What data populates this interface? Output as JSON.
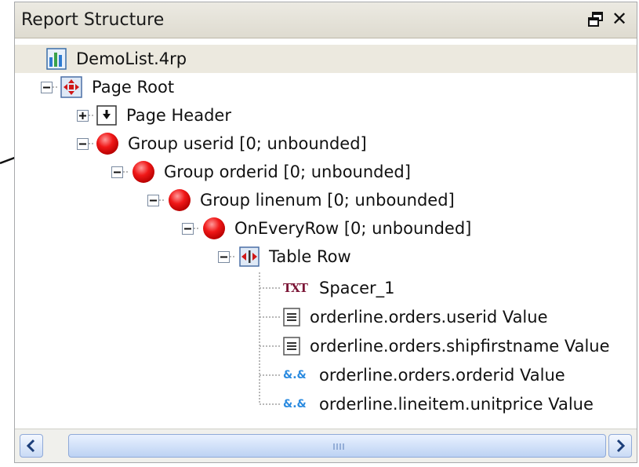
{
  "panel": {
    "title": "Report Structure",
    "buttons": {
      "pin_icon": "float-window-icon",
      "close_icon": "close-icon",
      "close_glyph": "✕"
    }
  },
  "tree": {
    "root": {
      "label": "DemoList.4rp",
      "icon": "report-file-icon"
    },
    "page_root": {
      "label": "Page Root",
      "icon": "page-root-icon"
    },
    "page_header": {
      "label": "Page Header",
      "icon": "page-header-icon"
    },
    "group_userid": {
      "label": "Group userid [0; unbounded]",
      "icon": "group-ball-icon"
    },
    "group_orderid": {
      "label": "Group orderid [0; unbounded]",
      "icon": "group-ball-icon"
    },
    "group_linenum": {
      "label": "Group linenum [0; unbounded]",
      "icon": "group-ball-icon"
    },
    "on_every_row": {
      "label": "OnEveryRow [0; unbounded]",
      "icon": "group-ball-icon"
    },
    "table_row": {
      "label": "Table Row",
      "icon": "table-row-icon"
    },
    "leaves": [
      {
        "label": "Spacer_1",
        "icon_text": "TXT",
        "icon": "text-field-icon"
      },
      {
        "label": "orderline.orders.userid Value",
        "icon": "string-value-icon"
      },
      {
        "label": "orderline.orders.shipfirstname Value",
        "icon": "string-value-icon"
      },
      {
        "label": "orderline.orders.orderid Value",
        "icon_text": "&.&",
        "icon": "numeric-value-icon"
      },
      {
        "label": "orderline.lineitem.unitprice Value",
        "icon_text": "&.&",
        "icon": "numeric-value-icon"
      }
    ]
  },
  "scrollbar": {
    "left_icon": "scroll-left-icon",
    "right_icon": "scroll-right-icon"
  },
  "colors": {
    "group_ball": "#e01010",
    "tree_line": "#a0a0a0",
    "scroll_blue": "#c9daf5"
  }
}
